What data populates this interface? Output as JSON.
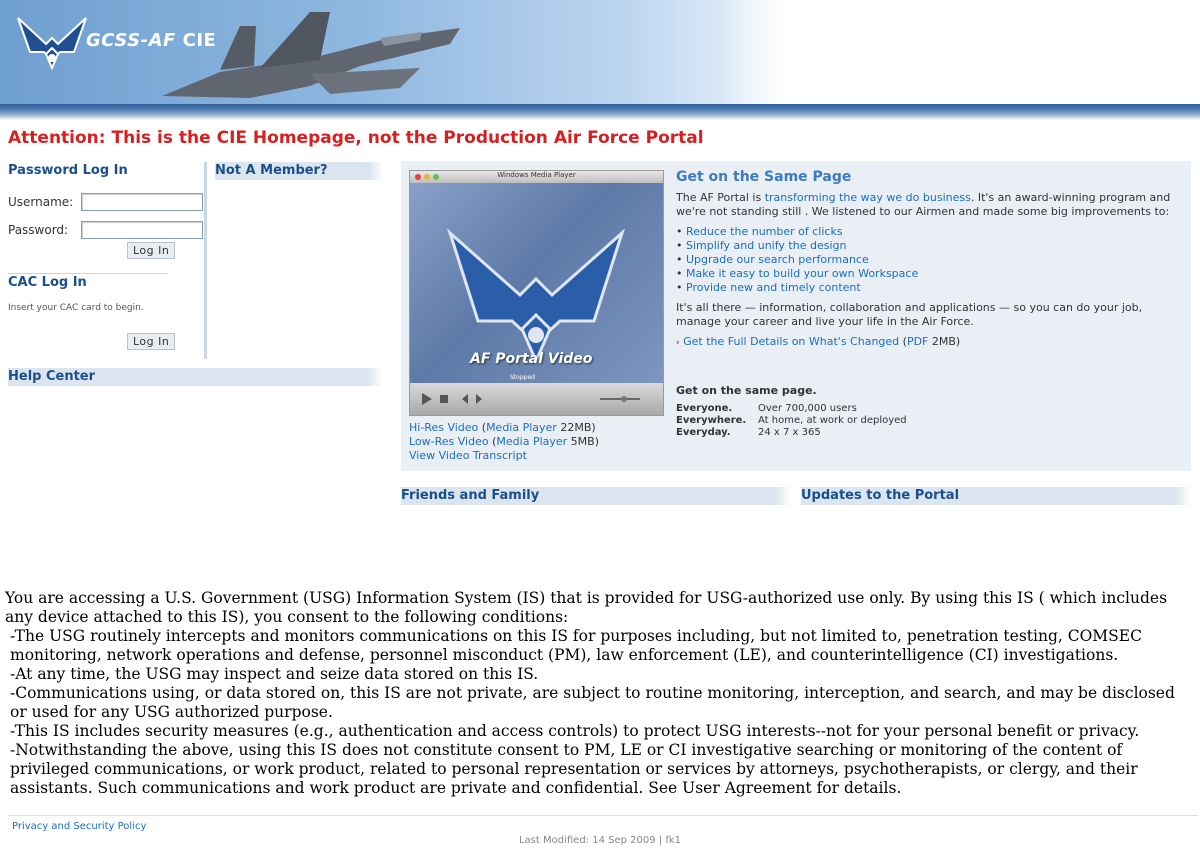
{
  "header": {
    "logo_text": "GCSS-AF",
    "logo_suffix": "CIE"
  },
  "attention": "Attention: This is the CIE Homepage, not the Production Air Force Portal",
  "login": {
    "title": "Password Log In",
    "username_label": "Username:",
    "password_label": "Password:",
    "login_button": "Log In",
    "username_value": "",
    "password_value": ""
  },
  "cac": {
    "title": "CAC Log In",
    "note": "Insert your CAC card to begin.",
    "login_button": "Log In"
  },
  "not_member": {
    "title": "Not A Member?"
  },
  "help": {
    "title": "Help Center"
  },
  "video": {
    "window_title": "Windows Media Player",
    "caption": "AF Portal Video",
    "status": "Stopped",
    "hires_label": "Hi-Res Video",
    "hires_player": "Media Player",
    "hires_size": "22MB)",
    "lores_label": "Low-Res Video",
    "lores_player": "Media Player",
    "lores_size": "5MB)",
    "transcript": "View Video Transcript"
  },
  "feature": {
    "title": "Get on the Same Page",
    "intro_prefix": "The AF Portal is ",
    "intro_link": "transforming the way we do business",
    "intro_suffix": ". It's an award-winning program and we're not standing still . We listened to our Airmen and made some big improvements to:",
    "bullets": [
      "Reduce the number of clicks",
      "Simplify and unify the design",
      "Upgrade our search performance",
      "Make it easy to build your own Workspace",
      "Provide new and timely content"
    ],
    "closing": "It's all there — information, collaboration and applications — so you can do your job, manage your career and live your life in the Air Force.",
    "details_link": "Get the Full Details on What's Changed",
    "pdf_label": "PDF",
    "pdf_size": "2MB)",
    "same_page": "Get on the same page.",
    "stats": [
      {
        "key": "Everyone.",
        "value": "Over 700,000 users"
      },
      {
        "key": "Everywhere.",
        "value": "At home, at work or deployed"
      },
      {
        "key": "Everyday.",
        "value": "24 x 7 x 365"
      }
    ]
  },
  "friends": {
    "title": "Friends and Family"
  },
  "updates": {
    "title": "Updates to the Portal"
  },
  "legal": {
    "intro": "You are accessing a U.S. Government (USG) Information System (IS) that is provided for USG-authorized use only. By using this IS ( which includes any device attached to this IS), you consent to the following conditions:",
    "items": [
      "-The USG routinely intercepts and monitors communications on this IS for purposes including, but not limited to, penetration testing, COMSEC monitoring, network operations and defense, personnel misconduct (PM), law enforcement (LE), and counterintelligence (CI) investigations.",
      "-At any time, the USG may inspect and seize data stored on this IS.",
      "-Communications using, or data stored on, this IS are not private, are subject to routine monitoring, interception, and search, and may be disclosed or used for any USG authorized purpose.",
      "-This IS includes security measures (e.g., authentication and access controls) to protect USG interests--not for your personal benefit or privacy.",
      "-Notwithstanding the above, using this IS does not constitute consent to PM, LE or CI investigative searching or monitoring of the content of privileged communications, or work product, related to personal representation or services by attorneys, psychotherapists, or clergy, and their assistants. Such communications and work product are private and confidential. See User Agreement for details."
    ]
  },
  "footer": {
    "privacy": "Privacy and Security Policy",
    "modified": "Last Modified: 14 Sep 2009 |   fk1"
  },
  "colors": {
    "attention": "#d81e1e",
    "section_header": "#1a4f8c",
    "link": "#1a6ec2",
    "header_bg": "#dbe5ef",
    "panel_bg": "#e9eff5"
  }
}
